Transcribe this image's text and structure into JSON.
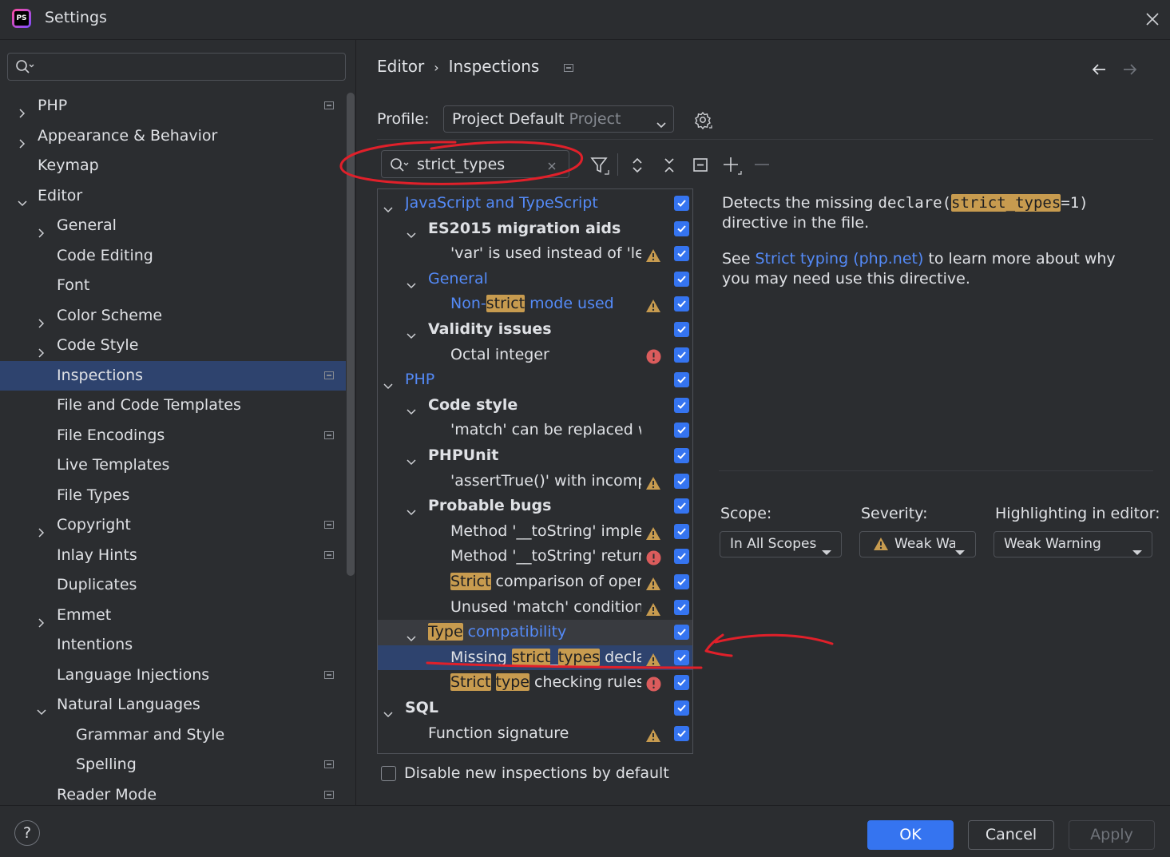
{
  "window": {
    "title": "Settings",
    "logo_text": "PS"
  },
  "nav": {
    "search_value": "",
    "items": [
      {
        "label": "PHP",
        "level": 0,
        "chevron": "right",
        "project": true
      },
      {
        "label": "Appearance & Behavior",
        "level": 0,
        "chevron": "right",
        "project": false
      },
      {
        "label": "Keymap",
        "level": 0,
        "chevron": "none",
        "project": false
      },
      {
        "label": "Editor",
        "level": 0,
        "chevron": "down",
        "project": false
      },
      {
        "label": "General",
        "level": 1,
        "chevron": "right",
        "project": false
      },
      {
        "label": "Code Editing",
        "level": 1,
        "chevron": "none",
        "project": false
      },
      {
        "label": "Font",
        "level": 1,
        "chevron": "none",
        "project": false
      },
      {
        "label": "Color Scheme",
        "level": 1,
        "chevron": "right",
        "project": false
      },
      {
        "label": "Code Style",
        "level": 1,
        "chevron": "right",
        "project": false
      },
      {
        "label": "Inspections",
        "level": 1,
        "chevron": "none",
        "project": true,
        "selected": true
      },
      {
        "label": "File and Code Templates",
        "level": 1,
        "chevron": "none",
        "project": false
      },
      {
        "label": "File Encodings",
        "level": 1,
        "chevron": "none",
        "project": true
      },
      {
        "label": "Live Templates",
        "level": 1,
        "chevron": "none",
        "project": false
      },
      {
        "label": "File Types",
        "level": 1,
        "chevron": "none",
        "project": false
      },
      {
        "label": "Copyright",
        "level": 1,
        "chevron": "right",
        "project": true
      },
      {
        "label": "Inlay Hints",
        "level": 1,
        "chevron": "none",
        "project": true
      },
      {
        "label": "Duplicates",
        "level": 1,
        "chevron": "none",
        "project": false
      },
      {
        "label": "Emmet",
        "level": 1,
        "chevron": "right",
        "project": false
      },
      {
        "label": "Intentions",
        "level": 1,
        "chevron": "none",
        "project": false
      },
      {
        "label": "Language Injections",
        "level": 1,
        "chevron": "none",
        "project": true
      },
      {
        "label": "Natural Languages",
        "level": 1,
        "chevron": "down",
        "project": false
      },
      {
        "label": "Grammar and Style",
        "level": 2,
        "chevron": "none",
        "project": false
      },
      {
        "label": "Spelling",
        "level": 2,
        "chevron": "none",
        "project": true
      },
      {
        "label": "Reader Mode",
        "level": 1,
        "chevron": "none",
        "project": true
      }
    ]
  },
  "breadcrumb": {
    "parent": "Editor",
    "separator": "›",
    "current": "Inspections"
  },
  "profile": {
    "label": "Profile:",
    "value": "Project Default",
    "value_suffix": "Project"
  },
  "filter": {
    "value": "strict_types"
  },
  "tree": [
    {
      "level": 0,
      "chevron": "down",
      "bold": false,
      "blue": true,
      "parts": [
        {
          "t": "JavaScript and TypeScript"
        }
      ],
      "icon": ""
    },
    {
      "level": 1,
      "chevron": "down",
      "bold": true,
      "blue": false,
      "parts": [
        {
          "t": "ES2015 migration aids"
        }
      ],
      "icon": ""
    },
    {
      "level": 2,
      "chevron": "none",
      "bold": false,
      "blue": false,
      "parts": [
        {
          "t": "'var' is used instead of 'let'"
        }
      ],
      "icon": "warning"
    },
    {
      "level": 1,
      "chevron": "down",
      "bold": false,
      "blue": true,
      "parts": [
        {
          "t": "General"
        }
      ],
      "icon": ""
    },
    {
      "level": 2,
      "chevron": "none",
      "bold": false,
      "blue": true,
      "parts": [
        {
          "t": "Non-"
        },
        {
          "t": "strict",
          "h": true
        },
        {
          "t": " mode used"
        }
      ],
      "icon": "warning"
    },
    {
      "level": 1,
      "chevron": "down",
      "bold": true,
      "blue": false,
      "parts": [
        {
          "t": "Validity issues"
        }
      ],
      "icon": ""
    },
    {
      "level": 2,
      "chevron": "none",
      "bold": false,
      "blue": false,
      "parts": [
        {
          "t": "Octal integer"
        }
      ],
      "icon": "error"
    },
    {
      "level": 0,
      "chevron": "down",
      "bold": false,
      "blue": true,
      "parts": [
        {
          "t": "PHP"
        }
      ],
      "icon": ""
    },
    {
      "level": 1,
      "chevron": "down",
      "bold": true,
      "blue": false,
      "parts": [
        {
          "t": "Code style"
        }
      ],
      "icon": ""
    },
    {
      "level": 2,
      "chevron": "none",
      "bold": false,
      "blue": false,
      "parts": [
        {
          "t": "'match' can be replaced w"
        }
      ],
      "icon": ""
    },
    {
      "level": 1,
      "chevron": "down",
      "bold": true,
      "blue": false,
      "parts": [
        {
          "t": "PHPUnit"
        }
      ],
      "icon": ""
    },
    {
      "level": 2,
      "chevron": "none",
      "bold": false,
      "blue": false,
      "parts": [
        {
          "t": "'assertTrue()' with incomp"
        }
      ],
      "icon": "warning"
    },
    {
      "level": 1,
      "chevron": "down",
      "bold": true,
      "blue": false,
      "parts": [
        {
          "t": "Probable bugs"
        }
      ],
      "icon": ""
    },
    {
      "level": 2,
      "chevron": "none",
      "bold": false,
      "blue": false,
      "parts": [
        {
          "t": "Method '__toString' implen"
        }
      ],
      "icon": "warning"
    },
    {
      "level": 2,
      "chevron": "none",
      "bold": false,
      "blue": false,
      "parts": [
        {
          "t": "Method '__toString' return"
        }
      ],
      "icon": "error"
    },
    {
      "level": 2,
      "chevron": "none",
      "bold": false,
      "blue": false,
      "parts": [
        {
          "t": "Strict",
          "h": true
        },
        {
          "t": " comparison of opera"
        }
      ],
      "icon": "warning"
    },
    {
      "level": 2,
      "chevron": "none",
      "bold": false,
      "blue": false,
      "parts": [
        {
          "t": "Unused 'match' condition"
        }
      ],
      "icon": "warning"
    },
    {
      "level": 1,
      "chevron": "down",
      "bold": false,
      "blue": true,
      "hover": true,
      "parts": [
        {
          "t": "Type",
          "h": true
        },
        {
          "t": " compatibility"
        }
      ],
      "icon": ""
    },
    {
      "level": 2,
      "chevron": "none",
      "bold": false,
      "blue": false,
      "selected": true,
      "parts": [
        {
          "t": "Missing "
        },
        {
          "t": "strict",
          "h": true
        },
        {
          "t": "_"
        },
        {
          "t": "types",
          "h": true
        },
        {
          "t": " declar"
        }
      ],
      "icon": "warning"
    },
    {
      "level": 2,
      "chevron": "none",
      "bold": false,
      "blue": false,
      "parts": [
        {
          "t": "Strict",
          "h": true
        },
        {
          "t": " "
        },
        {
          "t": "type",
          "h": true
        },
        {
          "t": " checking rules"
        }
      ],
      "icon": "error"
    },
    {
      "level": 0,
      "chevron": "down",
      "bold": true,
      "blue": false,
      "parts": [
        {
          "t": "SQL"
        }
      ],
      "icon": ""
    },
    {
      "level": 1,
      "chevron": "none",
      "bold": false,
      "blue": false,
      "parts": [
        {
          "t": "Function signature"
        }
      ],
      "icon": "warning"
    }
  ],
  "description": {
    "p1_a": "Detects the missing ",
    "p1_code1": "declare(",
    "p1_code_hl": "strict_types",
    "p1_code2": "=1)",
    "p1_b": " directive in the file.",
    "p2_a": "See ",
    "p2_link": "Strict typing (php.net)",
    "p2_b": " to learn more about why you may need use this directive."
  },
  "scope": {
    "label": "Scope:",
    "value": "In All Scopes"
  },
  "severity": {
    "label": "Severity:",
    "value": "Weak Wa..."
  },
  "highlighting": {
    "label": "Highlighting in editor:",
    "value": "Weak Warning"
  },
  "disable_new": {
    "label": "Disable new inspections by default",
    "checked": false
  },
  "buttons": {
    "help": "?",
    "ok": "OK",
    "cancel": "Cancel",
    "apply": "Apply"
  },
  "colors": {
    "accent": "#3574f0",
    "link": "#548af7",
    "highlight": "#c79b4f",
    "selection": "#2e436e",
    "annotation": "#e0202a"
  }
}
